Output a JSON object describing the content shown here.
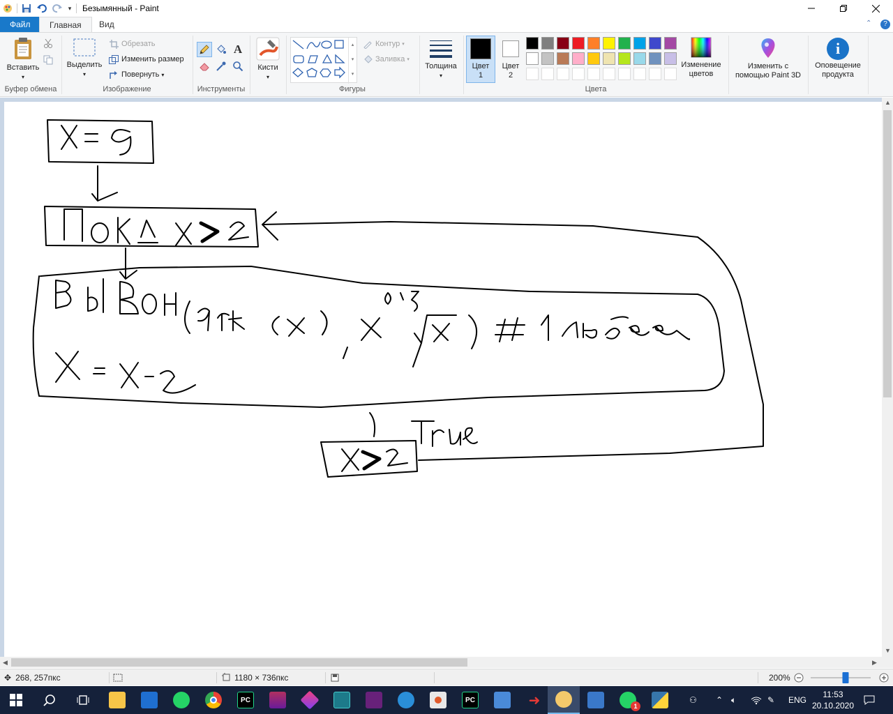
{
  "window": {
    "title": "Безымянный - Paint"
  },
  "tabs": {
    "file": "Файл",
    "home": "Главная",
    "view": "Вид"
  },
  "ribbon": {
    "clipboard": {
      "paste": "Вставить",
      "label": "Буфер обмена"
    },
    "image": {
      "select": "Выделить",
      "crop": "Обрезать",
      "resize": "Изменить размер",
      "rotate": "Повернуть",
      "label": "Изображение"
    },
    "tools": {
      "label": "Инструменты"
    },
    "brushes": {
      "label": "Кисти"
    },
    "shapes": {
      "outline": "Контур",
      "fill": "Заливка",
      "label": "Фигуры"
    },
    "size": {
      "label": "Толщина"
    },
    "colors": {
      "color1_line1": "Цвет",
      "color1_line2": "1",
      "color2_line1": "Цвет",
      "color2_line2": "2",
      "edit_line1": "Изменение",
      "edit_line2": "цветов",
      "label": "Цвета",
      "color1": "#000000",
      "color2": "#ffffff",
      "palette_row1": [
        "#000000",
        "#7f7f7f",
        "#880015",
        "#ed1c24",
        "#ff7f27",
        "#fff200",
        "#22b14c",
        "#00a2e8",
        "#3f48cc",
        "#a349a4"
      ],
      "palette_row2": [
        "#ffffff",
        "#c3c3c3",
        "#b97a57",
        "#ffaec9",
        "#ffc90e",
        "#efe4b0",
        "#b5e61d",
        "#99d9ea",
        "#7092be",
        "#c8bfe7"
      ]
    },
    "paint3d": {
      "line1": "Изменить с",
      "line2": "помощью Paint 3D"
    },
    "notice": {
      "line1": "Оповещение",
      "line2": "продукта"
    }
  },
  "status": {
    "cursor": "268, 257пкс",
    "size": "1180 × 736пкс",
    "zoom": "200%",
    "zoom_level": 0.58
  },
  "taskbar": {
    "lang": "ENG",
    "time": "11:53",
    "date": "20.10.2020",
    "whatsapp_badge": "1"
  }
}
